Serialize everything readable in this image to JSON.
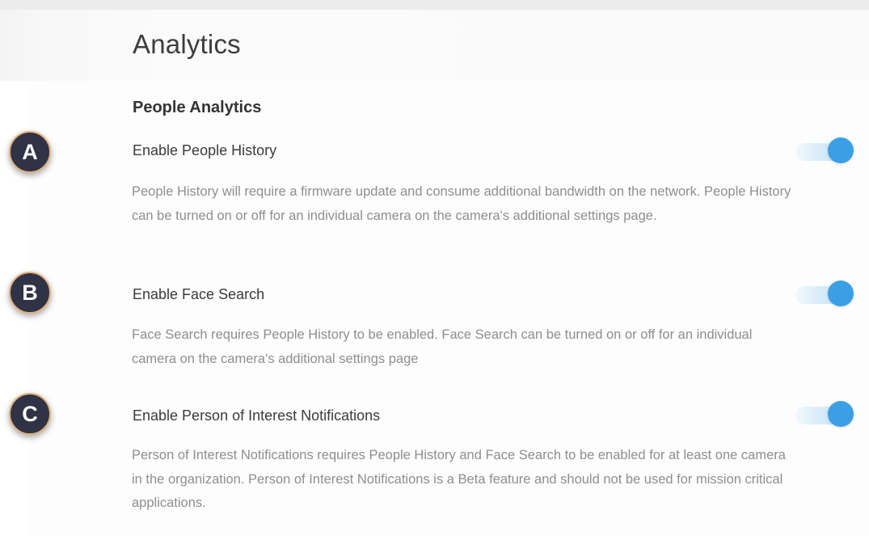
{
  "page": {
    "title": "Analytics"
  },
  "section": {
    "title": "People Analytics"
  },
  "settings": [
    {
      "marker": "A",
      "label": "Enable People History",
      "description": "People History will require a firmware update and consume additional bandwidth on the network. People History can be turned on or off for an individual camera on the camera's additional settings page.",
      "enabled": true
    },
    {
      "marker": "B",
      "label": "Enable Face Search",
      "description": "Face Search requires People History to be enabled. Face Search can be turned on or off for an individual camera on the camera's additional settings page",
      "enabled": true
    },
    {
      "marker": "C",
      "label": "Enable Person of Interest Notifications",
      "description": "Person of Interest Notifications requires People History and Face Search to be enabled for at least one camera in the organization. Person of Interest Notifications is a Beta feature and should not be used for mission critical applications.",
      "enabled": true
    }
  ],
  "colors": {
    "toggle_on": "#3b9fe5",
    "marker_bg": "#2f3345",
    "marker_ring": "#e4b27d"
  }
}
